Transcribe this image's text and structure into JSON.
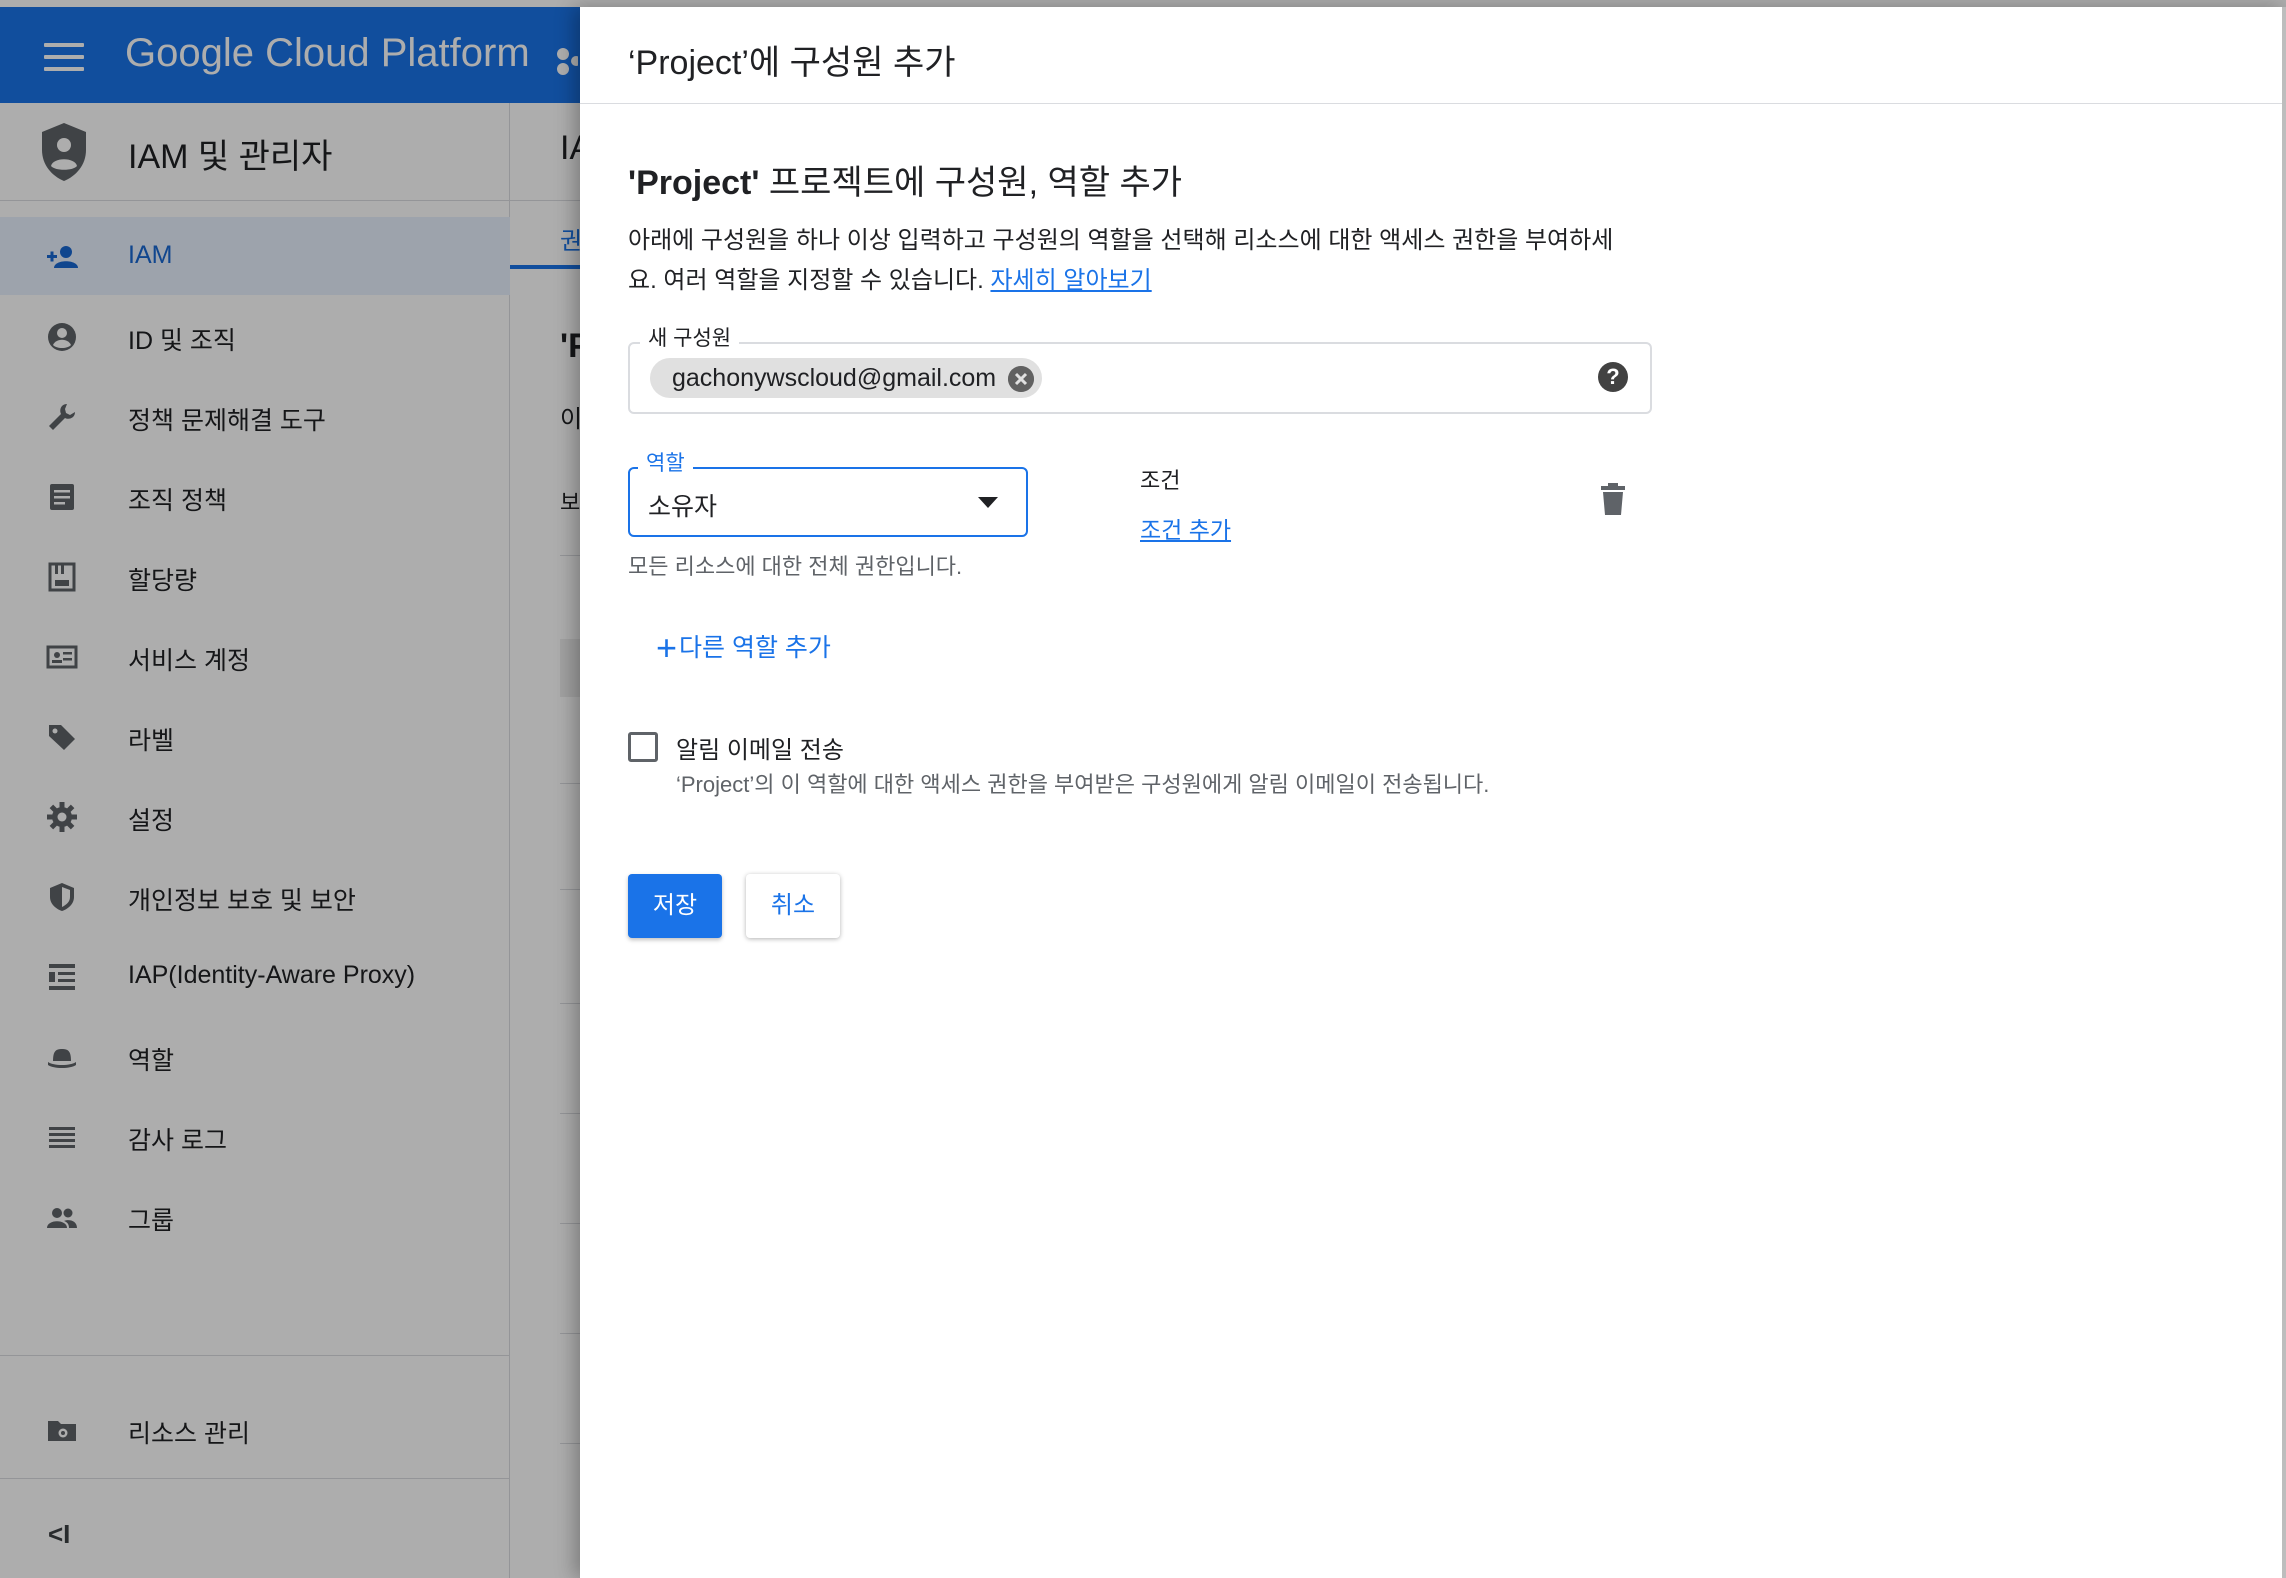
{
  "topbar": {
    "brand": "Google Cloud Platform"
  },
  "sidebar": {
    "title": "IAM 및 관리자",
    "items": [
      {
        "label": "IAM",
        "icon": "person-add-icon"
      },
      {
        "label": "ID 및 조직",
        "icon": "account-circle-icon"
      },
      {
        "label": "정책 문제해결 도구",
        "icon": "wrench-icon"
      },
      {
        "label": "조직 정책",
        "icon": "document-icon"
      },
      {
        "label": "할당량",
        "icon": "quota-icon"
      },
      {
        "label": "서비스 계정",
        "icon": "service-account-icon"
      },
      {
        "label": "라벨",
        "icon": "label-icon"
      },
      {
        "label": "설정",
        "icon": "gear-icon"
      },
      {
        "label": "개인정보 보호 및 보안",
        "icon": "shield-icon"
      },
      {
        "label": "IAP(Identity-Aware Proxy)",
        "icon": "iap-icon"
      },
      {
        "label": "역할",
        "icon": "hat-icon"
      },
      {
        "label": "감사 로그",
        "icon": "list-icon"
      },
      {
        "label": "그룹",
        "icon": "group-icon"
      }
    ],
    "footer_item": {
      "label": "리소스 관리",
      "icon": "folder-gear-icon"
    },
    "collapse": "<I"
  },
  "main": {
    "header": "IA",
    "tab": "권",
    "big": "'P",
    "line1": "이",
    "line2": "보"
  },
  "panel": {
    "header_title": "‘Project’에 구성원 추가",
    "section_title_bold": "'Project'",
    "section_title_rest": " 프로젝트에 구성원, 역할 추가",
    "description": "아래에 구성원을 하나 이상 입력하고 구성원의 역할을 선택해 리소스에 대한 액세스 권한을 부여하세요. 여러 역할을 지정할 수 있습니다.",
    "learn_more": "자세히 알아보기",
    "members_label": "새 구성원",
    "member_chip": "gachonywscloud@gmail.com",
    "role_label": "역할",
    "role_value": "소유자",
    "role_hint": "모든 리소스에 대한 전체 권한입니다.",
    "condition_label": "조건",
    "condition_link": "조건 추가",
    "add_role": "다른 역할 추가",
    "notify_label": "알림 이메일 전송",
    "notify_hint": "‘Project’의 이 역할에 대한 액세스 권한을 부여받은 구성원에게 알림 이메일이 전송됩니다.",
    "notify_checked": false,
    "save": "저장",
    "cancel": "취소"
  },
  "colors": {
    "accent": "#1a73e8",
    "scrim": "rgba(0,0,0,0.32)"
  }
}
